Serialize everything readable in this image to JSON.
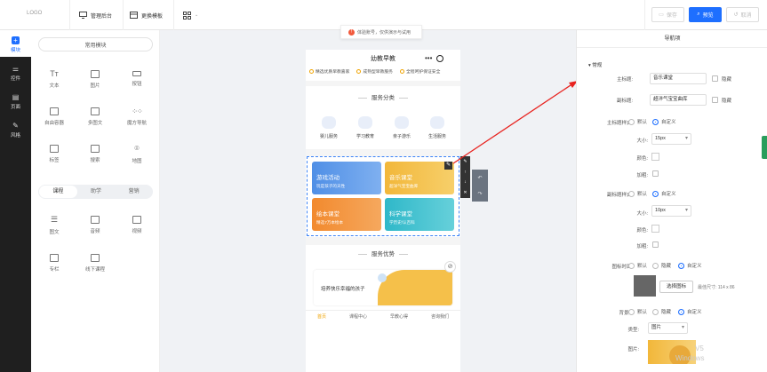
{
  "topbar": {
    "logo": "LOGO",
    "items": [
      {
        "label": "管理后台",
        "icon": "monitor-icon"
      },
      {
        "label": "更换模板",
        "icon": "template-icon"
      }
    ],
    "save_label": "保存",
    "preview_label": "预览",
    "cancel_label": "取消"
  },
  "leftnav": [
    {
      "label": "模块",
      "icon": "plus-square-icon"
    },
    {
      "label": "控件",
      "icon": "sliders-icon"
    },
    {
      "label": "页面",
      "icon": "page-icon"
    },
    {
      "label": "风格",
      "icon": "brush-icon"
    }
  ],
  "palette": {
    "common_header": "常用模块",
    "common": [
      "文本",
      "图片",
      "按钮",
      "自由容器",
      "多图文",
      "魔方导航",
      "标签",
      "搜索",
      "地图"
    ],
    "tabs": [
      "课程",
      "助学",
      "营销"
    ],
    "course": [
      "图文",
      "音频",
      "视频",
      "专栏",
      "线下课程"
    ]
  },
  "notice": "体验账号，仅供演示与试用",
  "phone": {
    "title": "幼教早教",
    "tags": [
      "精选优质早教嘉家",
      "成熟型早教服务",
      "全程呵护保证安全"
    ],
    "services_title": "服务分类",
    "services": [
      "婴儿服务",
      "学习教育",
      "亲子游乐",
      "生活服务"
    ],
    "cards": [
      {
        "title": "游戏活动",
        "sub": "玩是孩子的天性"
      },
      {
        "title": "音乐课堂",
        "sub": "超洋气宝宝曲库"
      },
      {
        "title": "绘本课堂",
        "sub": "精选7万本绘本"
      },
      {
        "title": "科学课堂",
        "sub": "学历史/认百科"
      }
    ],
    "advantage_title": "服务优势",
    "advantage_text": "培养快乐幸福的孩子",
    "bottom_nav": [
      "首页",
      "课程中心",
      "早教心得",
      "咨询我们"
    ]
  },
  "rightpanel": {
    "title": "导航项",
    "section": "常规",
    "main_title_label": "主标题:",
    "main_title_value": "音乐课堂",
    "sub_title_label": "副标题:",
    "sub_title_value": "超洋气宝宝曲库",
    "hide_label": "隐藏",
    "main_style_label": "主标题样式:",
    "sub_style_label": "副标题样式:",
    "default_label": "默认",
    "custom_label": "自定义",
    "size_label": "大小:",
    "main_size": "15px",
    "sub_size": "10px",
    "color_label": "颜色:",
    "bold_label": "加粗:",
    "icon_label": "图标时面:",
    "choose_icon": "选择图标",
    "best_size": "最佳尺寸: 114 x 86",
    "bg_label": "背景:",
    "type_label": "类型:",
    "type_value": "图片",
    "image_label": "图片:"
  },
  "watermark": [
    "V5",
    "Windows"
  ],
  "colors": {
    "accent": "#1e6fff",
    "card1": "#4f8fe6",
    "card2": "#f2b73a",
    "card3": "#f28a2e",
    "card4": "#2fb8c9",
    "arrow": "#e8231f"
  }
}
